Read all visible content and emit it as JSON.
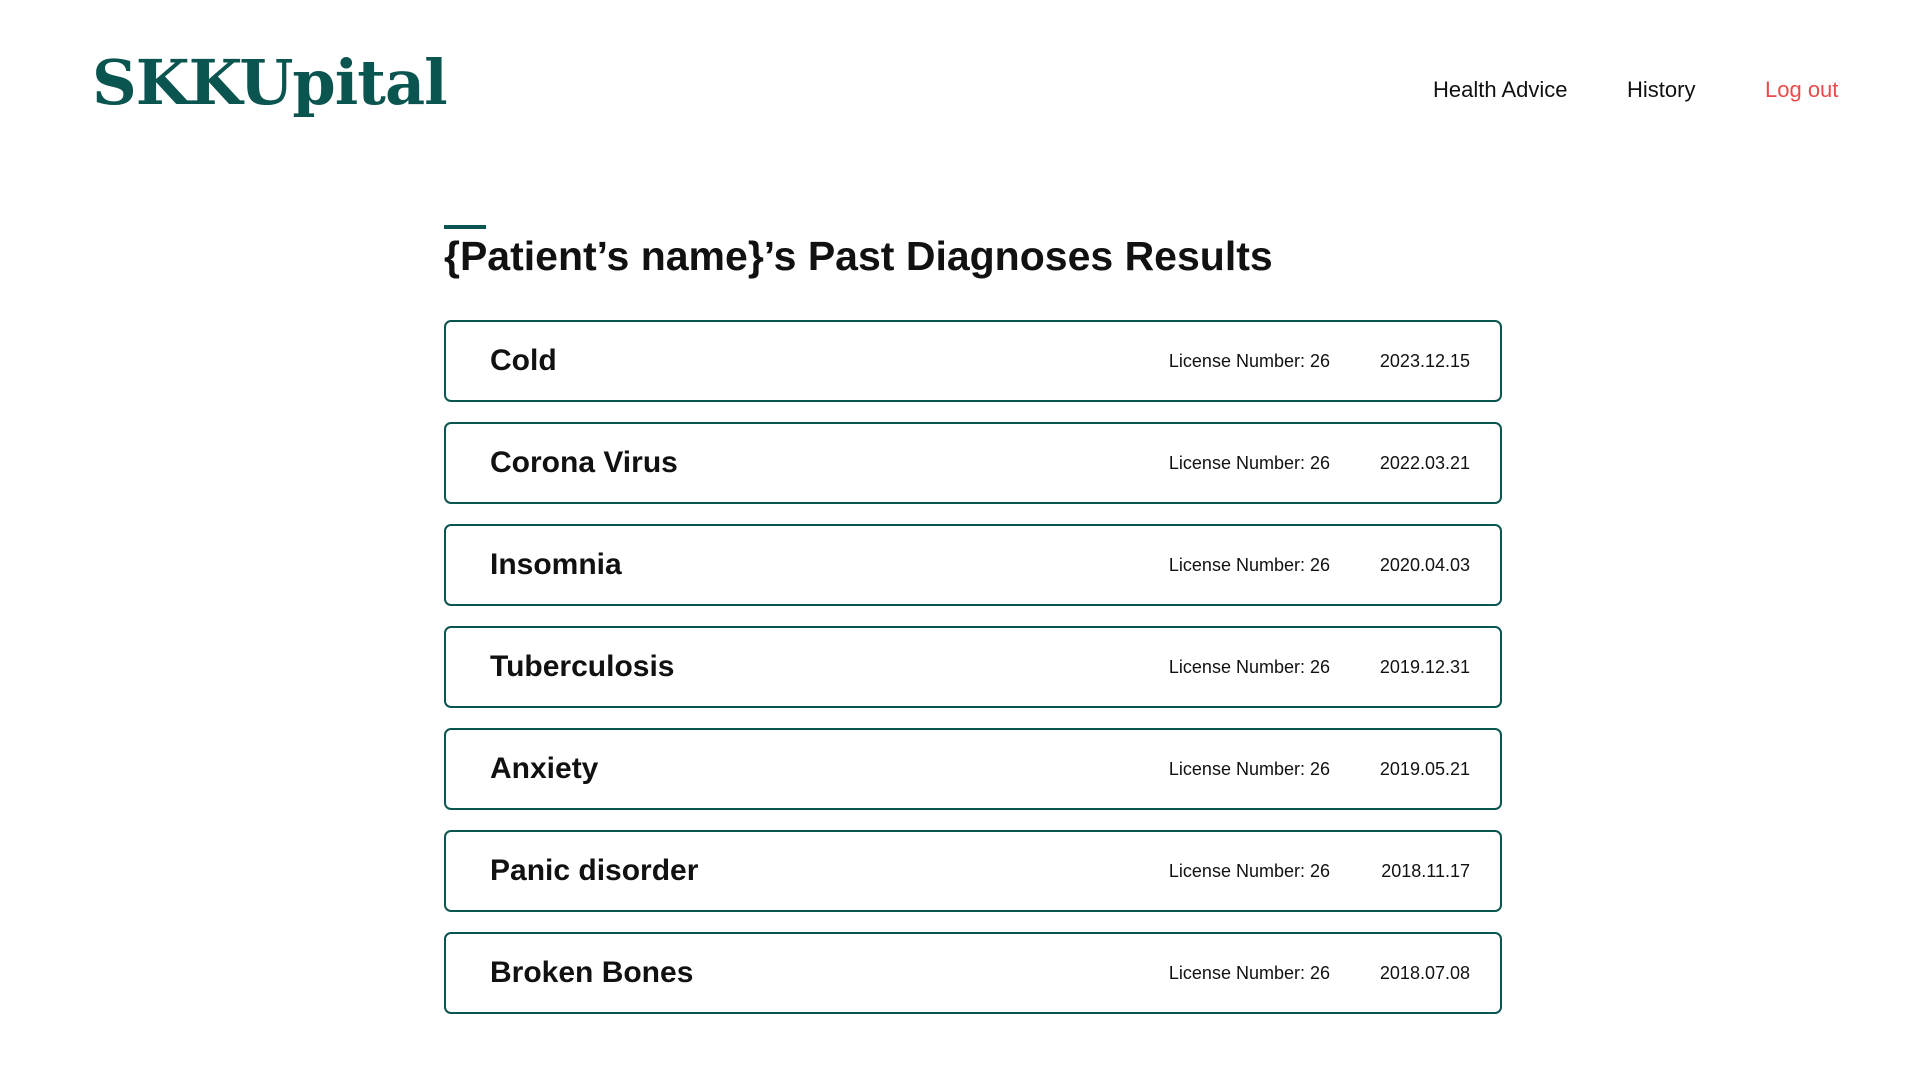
{
  "header": {
    "logo": "SKKUpital",
    "nav": {
      "health_advice": "Health Advice",
      "history": "History",
      "logout": "Log out"
    }
  },
  "main": {
    "title": "{Patient’s name}’s Past Diagnoses Results",
    "diagnoses": [
      {
        "name": "Cold",
        "license": "License Number: 26",
        "date": "2023.12.15"
      },
      {
        "name": "Corona Virus",
        "license": "License Number: 26",
        "date": "2022.03.21"
      },
      {
        "name": "Insomnia",
        "license": "License Number: 26",
        "date": "2020.04.03"
      },
      {
        "name": "Tuberculosis",
        "license": "License Number: 26",
        "date": "2019.12.31"
      },
      {
        "name": "Anxiety",
        "license": "License Number: 26",
        "date": "2019.05.21"
      },
      {
        "name": "Panic disorder",
        "license": "License Number: 26",
        "date": "2018.11.17"
      },
      {
        "name": "Broken Bones",
        "license": "License Number: 26",
        "date": "2018.07.08"
      }
    ]
  },
  "colors": {
    "brand": "#0b5550",
    "logout": "#e94b4b",
    "text": "#111111"
  }
}
